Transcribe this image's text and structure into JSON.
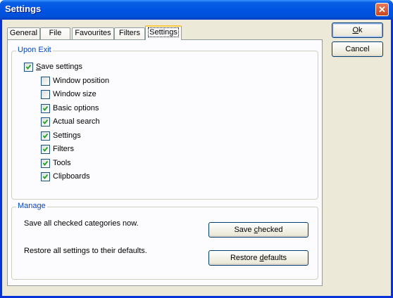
{
  "window": {
    "title": "Settings",
    "close_glyph": "✕"
  },
  "tabs": [
    {
      "label": "General",
      "active": false
    },
    {
      "label": "File",
      "active": false
    },
    {
      "label": "Favourites",
      "active": false
    },
    {
      "label": "Filters",
      "active": false
    },
    {
      "label": "Settings",
      "active": true
    }
  ],
  "upon_exit": {
    "group_label": "Upon Exit",
    "save_settings": {
      "label_first": "S",
      "label_rest": "ave settings",
      "checked": true
    },
    "items": [
      {
        "label": "Window position",
        "checked": false
      },
      {
        "label": "Window size",
        "checked": false
      },
      {
        "label": "Basic options",
        "checked": true
      },
      {
        "label": "Actual search",
        "checked": true
      },
      {
        "label": "Settings",
        "checked": true
      },
      {
        "label": "Filters",
        "checked": true
      },
      {
        "label": "Tools",
        "checked": true
      },
      {
        "label": "Clipboards",
        "checked": true
      }
    ]
  },
  "manage": {
    "group_label": "Manage",
    "save_text": "Save all checked categories now.",
    "restore_text": "Restore all settings to their defaults.",
    "save_button": {
      "pre": "Save ",
      "accel": "c",
      "post": "hecked"
    },
    "restore_button": {
      "pre": "Restore ",
      "accel": "d",
      "post": "efaults"
    }
  },
  "buttons": {
    "ok": {
      "accel": "O",
      "rest": "k"
    },
    "cancel": "Cancel"
  },
  "colors": {
    "title_bar": "#0054e3",
    "group_label": "#0046d5",
    "dialog_bg": "#ece9d8",
    "check": "#21a121"
  }
}
